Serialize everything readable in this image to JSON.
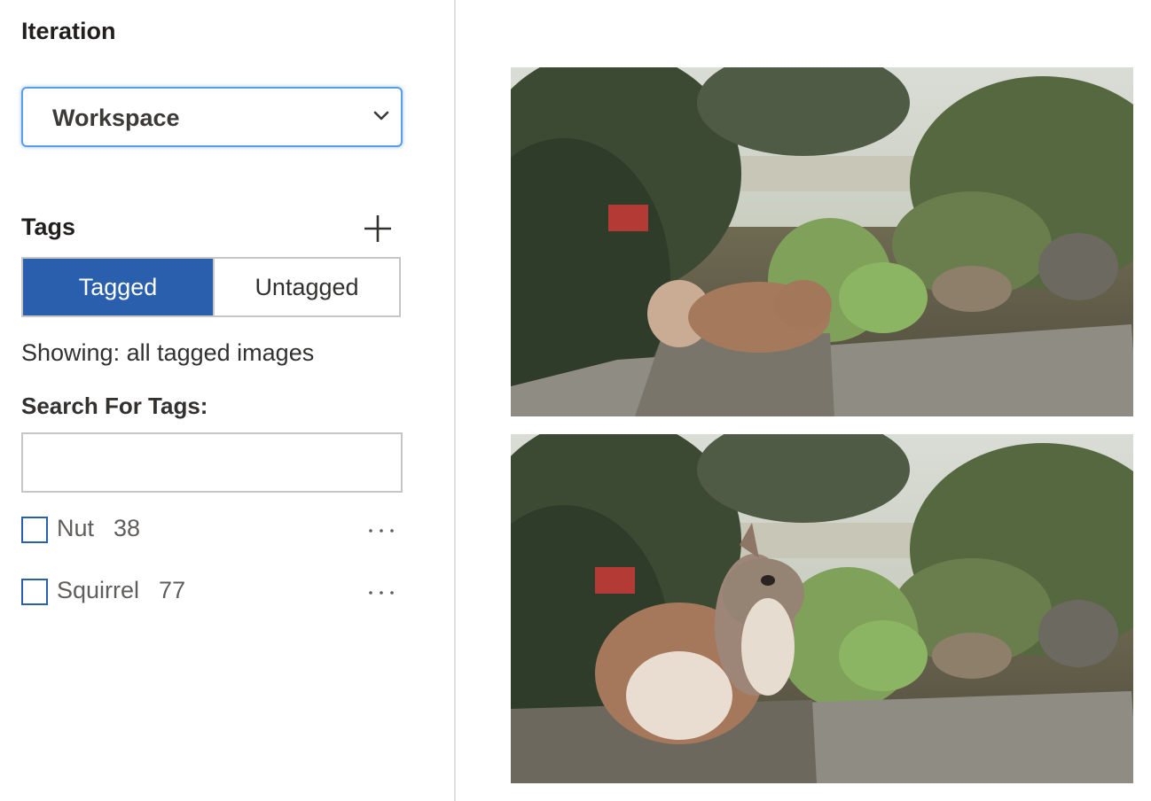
{
  "iteration": {
    "heading": "Iteration",
    "selected": "Workspace"
  },
  "tags": {
    "heading": "Tags",
    "filter": {
      "tagged_label": "Tagged",
      "untagged_label": "Untagged",
      "active": "Tagged"
    },
    "showing_text": "Showing: all tagged images",
    "search_label": "Search For Tags:",
    "search_value": "",
    "items": [
      {
        "name": "Nut",
        "count": "38",
        "checked": false
      },
      {
        "name": "Squirrel",
        "count": "77",
        "checked": false
      }
    ]
  },
  "images": [
    {
      "subject": "squirrel-facing-away"
    },
    {
      "subject": "squirrel-sitting"
    }
  ],
  "colors": {
    "accent": "#2a5fad",
    "focus_border": "#5a9ee8",
    "border": "#c8c6c4"
  },
  "icons": {
    "select_chevron": "chevron-down-icon",
    "add_tag": "plus-icon",
    "tag_menu": "more-horizontal-icon"
  }
}
